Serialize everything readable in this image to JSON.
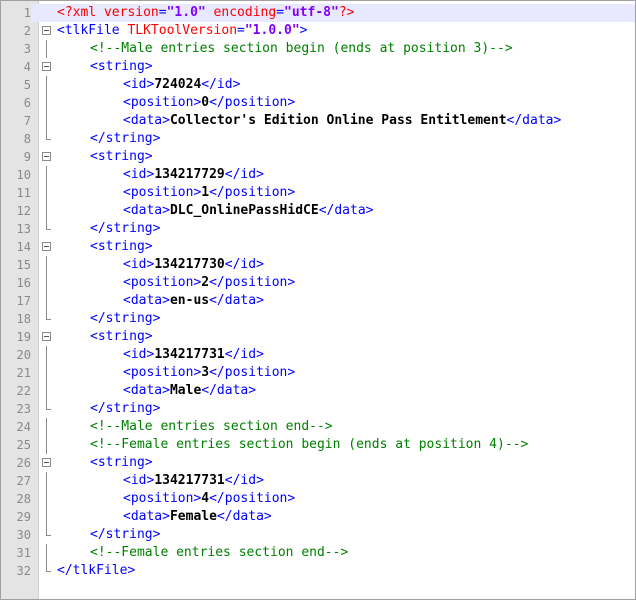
{
  "editor": {
    "lines": [
      {
        "n": "1",
        "fold": "none",
        "indent": 0,
        "tokens": [
          {
            "t": "pi",
            "v": "<?xml "
          },
          {
            "t": "attr",
            "v": "version"
          },
          {
            "t": "tag",
            "v": "="
          },
          {
            "t": "val",
            "v": "\"1.0\""
          },
          {
            "t": "attr",
            "v": " encoding"
          },
          {
            "t": "tag",
            "v": "="
          },
          {
            "t": "val",
            "v": "\"utf-8\""
          },
          {
            "t": "pi",
            "v": "?>"
          }
        ]
      },
      {
        "n": "2",
        "fold": "open",
        "indent": 0,
        "tokens": [
          {
            "t": "tag",
            "v": "<tlkFile "
          },
          {
            "t": "attr",
            "v": "TLKToolVersion"
          },
          {
            "t": "tag",
            "v": "="
          },
          {
            "t": "val",
            "v": "\"1.0.0\""
          },
          {
            "t": "tag",
            "v": ">"
          }
        ]
      },
      {
        "n": "3",
        "fold": "line",
        "indent": 1,
        "tokens": [
          {
            "t": "comment",
            "v": "<!--Male entries section begin (ends at position 3)-->"
          }
        ]
      },
      {
        "n": "4",
        "fold": "open",
        "indent": 1,
        "tokens": [
          {
            "t": "tag",
            "v": "<string>"
          }
        ]
      },
      {
        "n": "5",
        "fold": "line",
        "indent": 2,
        "tokens": [
          {
            "t": "tag",
            "v": "<id>"
          },
          {
            "t": "txt",
            "v": "724024"
          },
          {
            "t": "tag",
            "v": "</id>"
          }
        ]
      },
      {
        "n": "6",
        "fold": "line",
        "indent": 2,
        "tokens": [
          {
            "t": "tag",
            "v": "<position>"
          },
          {
            "t": "txt",
            "v": "0"
          },
          {
            "t": "tag",
            "v": "</position>"
          }
        ]
      },
      {
        "n": "7",
        "fold": "line",
        "indent": 2,
        "tokens": [
          {
            "t": "tag",
            "v": "<data>"
          },
          {
            "t": "txt",
            "v": "Collector's Edition Online Pass Entitlement"
          },
          {
            "t": "tag",
            "v": "</data>"
          }
        ]
      },
      {
        "n": "8",
        "fold": "end",
        "indent": 1,
        "tokens": [
          {
            "t": "tag",
            "v": "</string>"
          }
        ]
      },
      {
        "n": "9",
        "fold": "open",
        "indent": 1,
        "tokens": [
          {
            "t": "tag",
            "v": "<string>"
          }
        ]
      },
      {
        "n": "10",
        "fold": "line",
        "indent": 2,
        "tokens": [
          {
            "t": "tag",
            "v": "<id>"
          },
          {
            "t": "txt",
            "v": "134217729"
          },
          {
            "t": "tag",
            "v": "</id>"
          }
        ]
      },
      {
        "n": "11",
        "fold": "line",
        "indent": 2,
        "tokens": [
          {
            "t": "tag",
            "v": "<position>"
          },
          {
            "t": "txt",
            "v": "1"
          },
          {
            "t": "tag",
            "v": "</position>"
          }
        ]
      },
      {
        "n": "12",
        "fold": "line",
        "indent": 2,
        "tokens": [
          {
            "t": "tag",
            "v": "<data>"
          },
          {
            "t": "txt",
            "v": "DLC_OnlinePassHidCE"
          },
          {
            "t": "tag",
            "v": "</data>"
          }
        ]
      },
      {
        "n": "13",
        "fold": "end",
        "indent": 1,
        "tokens": [
          {
            "t": "tag",
            "v": "</string>"
          }
        ]
      },
      {
        "n": "14",
        "fold": "open",
        "indent": 1,
        "tokens": [
          {
            "t": "tag",
            "v": "<string>"
          }
        ]
      },
      {
        "n": "15",
        "fold": "line",
        "indent": 2,
        "tokens": [
          {
            "t": "tag",
            "v": "<id>"
          },
          {
            "t": "txt",
            "v": "134217730"
          },
          {
            "t": "tag",
            "v": "</id>"
          }
        ]
      },
      {
        "n": "16",
        "fold": "line",
        "indent": 2,
        "tokens": [
          {
            "t": "tag",
            "v": "<position>"
          },
          {
            "t": "txt",
            "v": "2"
          },
          {
            "t": "tag",
            "v": "</position>"
          }
        ]
      },
      {
        "n": "17",
        "fold": "line",
        "indent": 2,
        "tokens": [
          {
            "t": "tag",
            "v": "<data>"
          },
          {
            "t": "txt",
            "v": "en-us"
          },
          {
            "t": "tag",
            "v": "</data>"
          }
        ]
      },
      {
        "n": "18",
        "fold": "end",
        "indent": 1,
        "tokens": [
          {
            "t": "tag",
            "v": "</string>"
          }
        ]
      },
      {
        "n": "19",
        "fold": "open",
        "indent": 1,
        "tokens": [
          {
            "t": "tag",
            "v": "<string>"
          }
        ]
      },
      {
        "n": "20",
        "fold": "line",
        "indent": 2,
        "tokens": [
          {
            "t": "tag",
            "v": "<id>"
          },
          {
            "t": "txt",
            "v": "134217731"
          },
          {
            "t": "tag",
            "v": "</id>"
          }
        ]
      },
      {
        "n": "21",
        "fold": "line",
        "indent": 2,
        "tokens": [
          {
            "t": "tag",
            "v": "<position>"
          },
          {
            "t": "txt",
            "v": "3"
          },
          {
            "t": "tag",
            "v": "</position>"
          }
        ]
      },
      {
        "n": "22",
        "fold": "line",
        "indent": 2,
        "tokens": [
          {
            "t": "tag",
            "v": "<data>"
          },
          {
            "t": "txt",
            "v": "Male"
          },
          {
            "t": "tag",
            "v": "</data>"
          }
        ]
      },
      {
        "n": "23",
        "fold": "end",
        "indent": 1,
        "tokens": [
          {
            "t": "tag",
            "v": "</string>"
          }
        ]
      },
      {
        "n": "24",
        "fold": "line",
        "indent": 1,
        "tokens": [
          {
            "t": "comment",
            "v": "<!--Male entries section end-->"
          }
        ]
      },
      {
        "n": "25",
        "fold": "line",
        "indent": 1,
        "tokens": [
          {
            "t": "comment",
            "v": "<!--Female entries section begin (ends at position 4)-->"
          }
        ]
      },
      {
        "n": "26",
        "fold": "open",
        "indent": 1,
        "tokens": [
          {
            "t": "tag",
            "v": "<string>"
          }
        ]
      },
      {
        "n": "27",
        "fold": "line",
        "indent": 2,
        "tokens": [
          {
            "t": "tag",
            "v": "<id>"
          },
          {
            "t": "txt",
            "v": "134217731"
          },
          {
            "t": "tag",
            "v": "</id>"
          }
        ]
      },
      {
        "n": "28",
        "fold": "line",
        "indent": 2,
        "tokens": [
          {
            "t": "tag",
            "v": "<position>"
          },
          {
            "t": "txt",
            "v": "4"
          },
          {
            "t": "tag",
            "v": "</position>"
          }
        ]
      },
      {
        "n": "29",
        "fold": "line",
        "indent": 2,
        "tokens": [
          {
            "t": "tag",
            "v": "<data>"
          },
          {
            "t": "txt",
            "v": "Female"
          },
          {
            "t": "tag",
            "v": "</data>"
          }
        ]
      },
      {
        "n": "30",
        "fold": "end",
        "indent": 1,
        "tokens": [
          {
            "t": "tag",
            "v": "</string>"
          }
        ]
      },
      {
        "n": "31",
        "fold": "line",
        "indent": 1,
        "tokens": [
          {
            "t": "comment",
            "v": "<!--Female entries section end-->"
          }
        ]
      },
      {
        "n": "32",
        "fold": "end",
        "indent": 0,
        "tokens": [
          {
            "t": "tag",
            "v": "</tlkFile>"
          }
        ]
      }
    ],
    "current_line": "1",
    "colors": {
      "tag": "#0000ff",
      "attribute": "#ff0000",
      "value": "#8000ff",
      "comment": "#008000",
      "gutter": "#e4e4e4",
      "current_line": "#e8e8ff"
    }
  }
}
